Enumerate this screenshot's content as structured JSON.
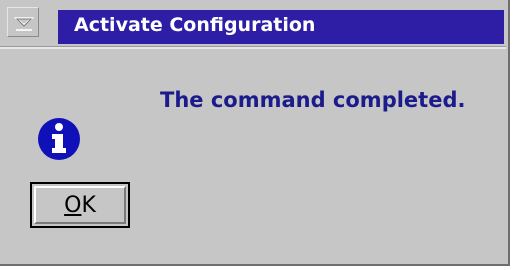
{
  "window": {
    "title": "Activate Configuration",
    "title_bar_color": "#2e1ea6"
  },
  "icons": {
    "system_menu": "system-menu-icon",
    "message_type": "info-icon"
  },
  "dialog": {
    "message": "The command completed.",
    "message_color": "#1b1b8c"
  },
  "buttons": {
    "ok_mnemonic": "O",
    "ok_rest": "K"
  }
}
